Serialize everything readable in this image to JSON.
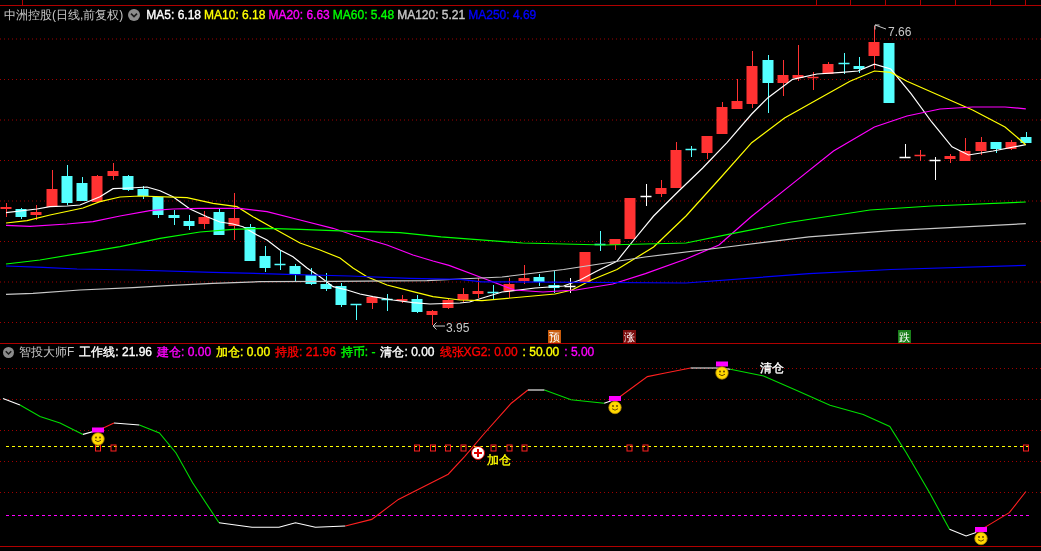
{
  "main_panel": {
    "title": "中洲控股(日线,前复权)",
    "legend": [
      {
        "text": "MA5: 6.18",
        "color": "#ffffff"
      },
      {
        "text": "MA10: 6.18",
        "color": "#ffff00"
      },
      {
        "text": "MA20: 6.63",
        "color": "#ff00ff"
      },
      {
        "text": "MA60: 5.48",
        "color": "#00ff00"
      },
      {
        "text": "MA120: 5.21",
        "color": "#c8c8c8"
      },
      {
        "text": "MA250: 4.69",
        "color": "#0000ff"
      }
    ],
    "annotations": [
      {
        "kind": "high",
        "text": "7.66"
      },
      {
        "kind": "low",
        "text": "3.95"
      }
    ],
    "signals": [
      {
        "text": "预",
        "color": "#c85a0a"
      },
      {
        "text": "涨",
        "color": "#7a0c0c"
      },
      {
        "text": "跌",
        "color": "#1a801a"
      }
    ]
  },
  "indicator_panel": {
    "title": "智投大师F",
    "readouts": [
      {
        "text": "工作线: 21.96",
        "color": "#ffffff"
      },
      {
        "text": "建仓: 0.00",
        "color": "#ff00ff"
      },
      {
        "text": "加仓: 0.00",
        "color": "#ffff00"
      },
      {
        "text": "持股: 21.96",
        "color": "#ff0000"
      },
      {
        "text": "持币: -",
        "color": "#00ff00"
      },
      {
        "text": "清仓: 0.00",
        "color": "#ffffff"
      },
      {
        "text": "线张XG2: 0.00",
        "color": "#ff0000"
      },
      {
        "text": ": 50.00",
        "color": "#ffff00"
      },
      {
        "text": ": 5.00",
        "color": "#ff00ff"
      }
    ],
    "annotations": [
      {
        "kind": "add",
        "text": "加仓",
        "color": "#ffff00"
      },
      {
        "kind": "clear",
        "text": "清仓",
        "color": "#ffffff"
      }
    ]
  }
}
